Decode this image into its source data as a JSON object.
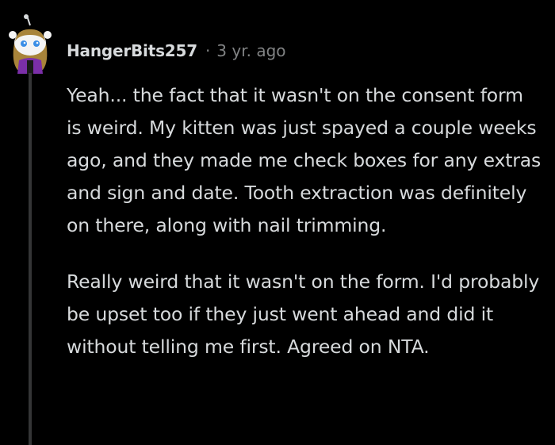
{
  "comment": {
    "username": "HangerBits257",
    "separator": "·",
    "timestamp": "3 yr. ago",
    "avatar_icon": "snoo-avatar-icon",
    "paragraphs": [
      "Yeah... the fact that it wasn't on the consent form is weird. My kitten was just spayed a couple weeks ago, and they made me check boxes for any extras and sign and date. Tooth extraction was definitely on there, along with nail trimming.",
      "Really weird that it wasn't on the form. I'd probably be upset too if they just went ahead and did it without telling me first. Agreed on NTA."
    ]
  },
  "colors": {
    "background": "#000000",
    "text": "#d7dadc",
    "muted": "#818384",
    "thread_line": "#343536",
    "avatar_shirt": "#7b2fa8",
    "avatar_hair": "#a8843a"
  }
}
